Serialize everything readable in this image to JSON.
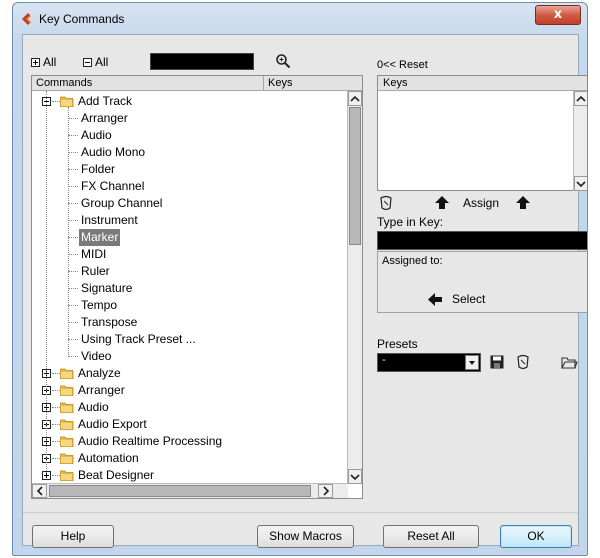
{
  "window": {
    "title": "Key Commands",
    "close_glyph": "x"
  },
  "toolbar": {
    "expand_all_label": "All",
    "collapse_all_label": "All",
    "search_value": ""
  },
  "tree": {
    "col_commands": "Commands",
    "col_keys": "Keys",
    "items": [
      {
        "label": "Add Track",
        "type": "folder",
        "expanded": true
      },
      {
        "label": "Arranger",
        "type": "leaf"
      },
      {
        "label": "Audio",
        "type": "leaf"
      },
      {
        "label": "Audio Mono",
        "type": "leaf"
      },
      {
        "label": "Folder",
        "type": "leaf"
      },
      {
        "label": "FX Channel",
        "type": "leaf"
      },
      {
        "label": "Group Channel",
        "type": "leaf"
      },
      {
        "label": "Instrument",
        "type": "leaf"
      },
      {
        "label": "Marker",
        "type": "leaf",
        "selected": true
      },
      {
        "label": "MIDI",
        "type": "leaf"
      },
      {
        "label": "Ruler",
        "type": "leaf"
      },
      {
        "label": "Signature",
        "type": "leaf"
      },
      {
        "label": "Tempo",
        "type": "leaf"
      },
      {
        "label": "Transpose",
        "type": "leaf"
      },
      {
        "label": "Using Track Preset ...",
        "type": "leaf"
      },
      {
        "label": "Video",
        "type": "leaf"
      },
      {
        "label": "Analyze",
        "type": "folder",
        "expanded": false
      },
      {
        "label": "Arranger",
        "type": "folder",
        "expanded": false
      },
      {
        "label": "Audio",
        "type": "folder",
        "expanded": false
      },
      {
        "label": "Audio Export",
        "type": "folder",
        "expanded": false
      },
      {
        "label": "Audio Realtime Processing",
        "type": "folder",
        "expanded": false
      },
      {
        "label": "Automation",
        "type": "folder",
        "expanded": false
      },
      {
        "label": "Beat Designer",
        "type": "folder",
        "expanded": false
      }
    ]
  },
  "right": {
    "reset_label": "Reset",
    "reset_prefix": "0<<",
    "keys_header": "Keys",
    "assign_label": "Assign",
    "type_in_key_label": "Type in Key:",
    "type_in_key_value": "",
    "assigned_to_label": "Assigned to:",
    "select_label": "Select",
    "presets_label": "Presets",
    "presets_value": "-"
  },
  "buttons": {
    "help": "Help",
    "show_macros": "Show Macros",
    "reset_all": "Reset All",
    "ok": "OK"
  },
  "colors": {
    "folder": "#e8b84a",
    "selection": "#7a7a7a",
    "field_bg": "#000000",
    "accent_blue": "#3c7fb1"
  }
}
